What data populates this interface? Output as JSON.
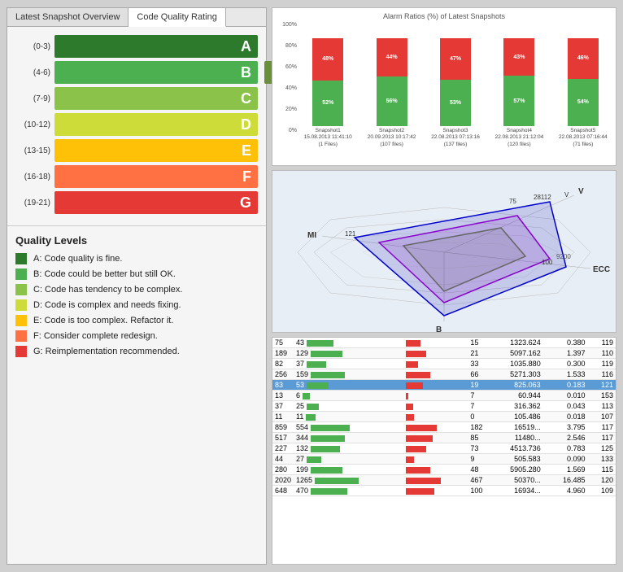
{
  "tabs": [
    {
      "label": "Latest Snapshot Overview",
      "active": false
    },
    {
      "label": "Code Quality Rating",
      "active": true
    }
  ],
  "ratings": [
    {
      "range": "(0-3)",
      "letter": "A",
      "color": "bar-a",
      "value": null,
      "width": "60%"
    },
    {
      "range": "(4-6)",
      "letter": "B",
      "color": "bar-b",
      "value": "4",
      "width": "68%"
    },
    {
      "range": "(7-9)",
      "letter": "C",
      "color": "bar-c",
      "value": null,
      "width": "76%"
    },
    {
      "range": "(10-12)",
      "letter": "D",
      "color": "bar-d",
      "value": null,
      "width": "84%"
    },
    {
      "range": "(13-15)",
      "letter": "E",
      "color": "bar-e",
      "value": null,
      "width": "88%"
    },
    {
      "range": "(16-18)",
      "letter": "F",
      "color": "bar-f",
      "value": null,
      "width": "92%"
    },
    {
      "range": "(19-21)",
      "letter": "G",
      "color": "bar-g",
      "value": null,
      "width": "96%"
    }
  ],
  "quality_levels_title": "Quality Levels",
  "quality_items": [
    {
      "color": "#2d7a2d",
      "text": "A: Code quality is fine."
    },
    {
      "color": "#4caf50",
      "text": "B: Code could be better but still OK."
    },
    {
      "color": "#8bc34a",
      "text": "C: Code has tendency to be complex."
    },
    {
      "color": "#cddc39",
      "text": "D: Code is complex and needs fixing."
    },
    {
      "color": "#ffc107",
      "text": "E: Code is too complex. Refactor it."
    },
    {
      "color": "#ff7043",
      "text": "F: Consider complete redesign."
    },
    {
      "color": "#e53935",
      "text": "G: Reimplementation recommended."
    }
  ],
  "chart_title": "Alarm Ratios (%) of Latest Snapshots",
  "chart_y_labels": [
    "100%",
    "80%",
    "60%",
    "40%",
    "20%",
    "0%"
  ],
  "chart_columns": [
    {
      "label": "Snapshot1\n15.08.2013 11:41:10\n(1 Files)",
      "green_h": 52,
      "red_h": 48,
      "green_pct": "52%",
      "red_pct": "48%"
    },
    {
      "label": "Snapshot2\n20.09.2013 10:17:42\n(107 files)",
      "green_h": 56,
      "red_h": 44,
      "green_pct": "56%",
      "red_pct": "44%"
    },
    {
      "label": "Snapshot3\n22.08.2013 07:13:16\n(137 files)",
      "green_h": 53,
      "red_h": 47,
      "green_pct": "53%",
      "red_pct": "47%"
    },
    {
      "label": "Snapshot4\n22.08.2013 21:12:04\n(120 files)",
      "green_h": 57,
      "red_h": 43,
      "green_pct": "57%",
      "red_pct": "43%"
    },
    {
      "label": "Snapshot5\n22.08.2013 07:16:44\n(71 files)",
      "green_h": 54,
      "red_h": 46,
      "green_pct": "54%",
      "red_pct": "46%"
    }
  ],
  "spider_labels": [
    "MI",
    "V",
    "ECC",
    "B"
  ],
  "table_rows": [
    {
      "cols": [
        "75",
        "43",
        "",
        "15",
        "1323.624",
        "0.380",
        "119"
      ],
      "highlight": false,
      "green1": 55,
      "red1": 35
    },
    {
      "cols": [
        "189",
        "129",
        "",
        "21",
        "5097.162",
        "1.397",
        "110"
      ],
      "highlight": false,
      "green1": 65,
      "red1": 50
    },
    {
      "cols": [
        "82",
        "37",
        "",
        "33",
        "1035.880",
        "0.300",
        "119"
      ],
      "highlight": false,
      "green1": 40,
      "red1": 30
    },
    {
      "cols": [
        "256",
        "159",
        "",
        "66",
        "5271.303",
        "1.533",
        "116"
      ],
      "highlight": false,
      "green1": 70,
      "red1": 60
    },
    {
      "cols": [
        "83",
        "53",
        "",
        "19",
        "825.063",
        "0.183",
        "121"
      ],
      "highlight": true,
      "green1": 45,
      "red1": 42
    },
    {
      "cols": [
        "13",
        "6",
        "",
        "7",
        "60.944",
        "0.010",
        "153"
      ],
      "highlight": false,
      "green1": 15,
      "red1": 5
    },
    {
      "cols": [
        "37",
        "25",
        "",
        "7",
        "316.362",
        "0.043",
        "113"
      ],
      "highlight": false,
      "green1": 25,
      "red1": 18
    },
    {
      "cols": [
        "11",
        "11",
        "",
        "0",
        "105.486",
        "0.018",
        "107"
      ],
      "highlight": false,
      "green1": 20,
      "red1": 20
    },
    {
      "cols": [
        "859",
        "554",
        "",
        "182",
        "16519...",
        "3.795",
        "117"
      ],
      "highlight": false,
      "green1": 80,
      "red1": 75
    },
    {
      "cols": [
        "517",
        "344",
        "",
        "85",
        "11480...",
        "2.546",
        "117"
      ],
      "highlight": false,
      "green1": 70,
      "red1": 65
    },
    {
      "cols": [
        "227",
        "132",
        "",
        "73",
        "4513.736",
        "0.783",
        "125"
      ],
      "highlight": false,
      "green1": 60,
      "red1": 50
    },
    {
      "cols": [
        "44",
        "27",
        "",
        "9",
        "505.583",
        "0.090",
        "133"
      ],
      "highlight": false,
      "green1": 30,
      "red1": 20
    },
    {
      "cols": [
        "280",
        "199",
        "",
        "48",
        "5905.280",
        "1.569",
        "115"
      ],
      "highlight": false,
      "green1": 65,
      "red1": 60
    },
    {
      "cols": [
        "2020",
        "1265",
        "",
        "467",
        "50370...",
        "16.485",
        "120"
      ],
      "highlight": false,
      "green1": 90,
      "red1": 85
    },
    {
      "cols": [
        "648",
        "470",
        "",
        "100",
        "16934...",
        "4.960",
        "109"
      ],
      "highlight": false,
      "green1": 75,
      "red1": 70
    }
  ]
}
